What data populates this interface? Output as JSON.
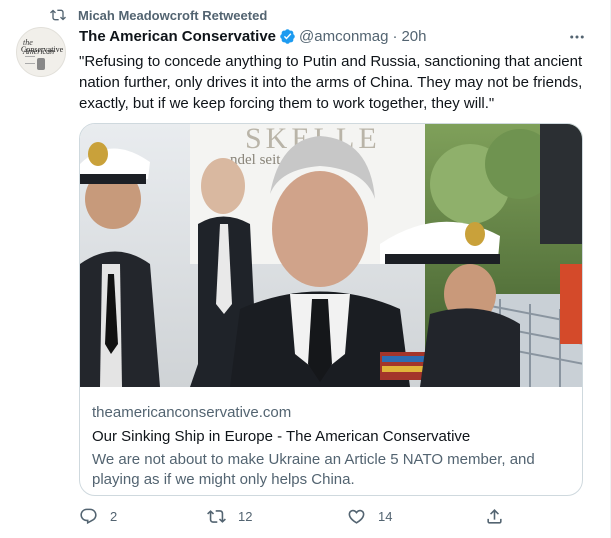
{
  "retweet_context": {
    "label": "Micah Meadowcroft Retweeted"
  },
  "author": {
    "name": "The American Conservative",
    "handle": "@amconmag",
    "time": "20h",
    "dot": "·",
    "avatar_masthead_line1": "the American",
    "avatar_masthead_line2": "Conservative"
  },
  "tweet": {
    "text": "\"Refusing to concede anything to Putin and Russia, sanctioning that ancient nation further, only drives it into the arms of China. They may not be friends, exactly, but if we keep forcing them to work together, they will.\""
  },
  "card": {
    "image_background_text": "SKELLE",
    "image_background_sub": "ndel seit 1405",
    "domain": "theamericanconservative.com",
    "title": "Our Sinking Ship in Europe - The American Conservative",
    "description": "We are not about to make Ukraine an Article 5 NATO member, and playing as if we might only helps China."
  },
  "actions": {
    "replies": "2",
    "retweets": "12",
    "likes": "14"
  },
  "colors": {
    "secondary_text": "#536471",
    "verified": "#1d9bf0",
    "border": "#cfd9de"
  }
}
